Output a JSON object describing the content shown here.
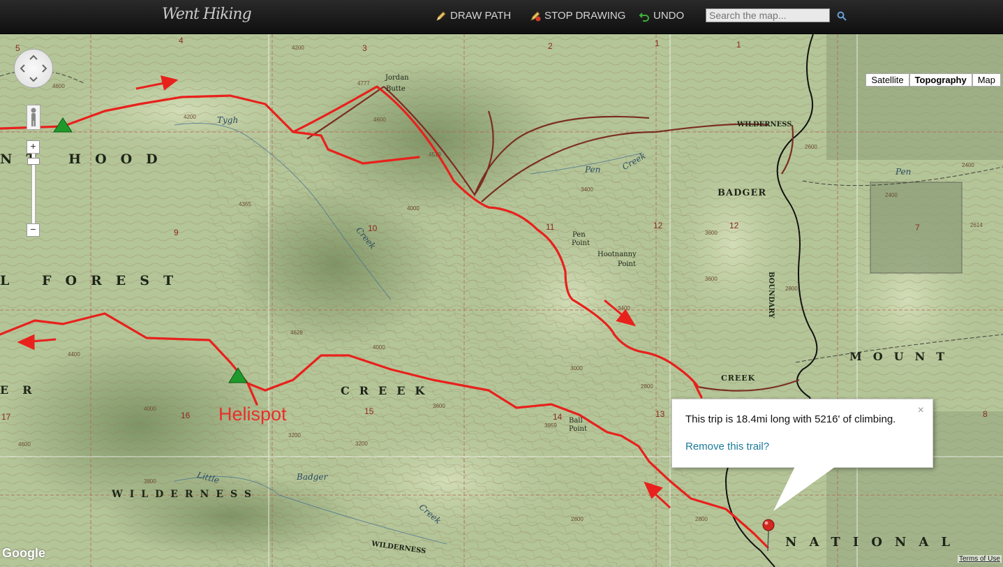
{
  "app": {
    "logo": "Went Hiking"
  },
  "toolbar": {
    "draw_path": "DRAW PATH",
    "stop_drawing": "STOP DRAWING",
    "undo": "UNDO",
    "search_placeholder": "Search the map..."
  },
  "map_types": [
    {
      "label": "Satellite",
      "active": false
    },
    {
      "label": "Topography",
      "active": true
    },
    {
      "label": "Map",
      "active": false
    }
  ],
  "zoom": {
    "in": "+",
    "out": "−"
  },
  "map_labels": {
    "forest_1": "NT HOOD",
    "forest_2": "L FOREST",
    "forest_3": "CREEK",
    "forest_4": "ER",
    "wilderness": "WILDERNESS",
    "mount": "MOUNT",
    "national": "NATIONAL",
    "badger": "BADGER",
    "creek_label": "CREEK",
    "wilderness_small": "WILDERNESS",
    "wilderness_small_2": "WILDERNESS",
    "boundary": "BOUNDARY",
    "jordan_butte_1": "Jordan",
    "jordan_butte_2": "Butte",
    "pen_point_1": "Pen",
    "pen_point_2": "Point",
    "hootnanny_1": "Hootnanny",
    "hootnanny_2": "Point",
    "ball_point_1": "Ball",
    "ball_point_2": "Point",
    "tygh": "Tygh",
    "creek_10": "Creek",
    "pen_creek": "Pen",
    "pen_creek_2": "Creek",
    "pen_east": "Pen",
    "little": "Little",
    "badger_creek": "Badger",
    "creek_bottom": "Creek"
  },
  "sections": [
    "5",
    "4",
    "3",
    "2",
    "1",
    "1",
    "9",
    "10",
    "11",
    "12",
    "12",
    "7",
    "17",
    "16",
    "15",
    "14",
    "13",
    "8"
  ],
  "contours": [
    "4600",
    "4200",
    "4777",
    "4600",
    "4519",
    "4200",
    "4365",
    "4000",
    "3400",
    "3600",
    "3400",
    "4628",
    "3200",
    "4000",
    "3600",
    "3000",
    "2800",
    "3959",
    "2800",
    "2600",
    "2400",
    "2400",
    "2614",
    "2800",
    "3600",
    "4400",
    "4600",
    "3800",
    "4000",
    "3200",
    "2800"
  ],
  "helispot": "Helispot",
  "info": {
    "text": "This trip is 18.4mi long with 5216' of climbing.",
    "link": "Remove this trail?",
    "close": "×"
  },
  "footer": {
    "google": "Google",
    "terms": "Terms of Use"
  },
  "colors": {
    "route": "#e8211c",
    "trailhead": "#1f9a2a",
    "section_text": "#8b2a20"
  }
}
